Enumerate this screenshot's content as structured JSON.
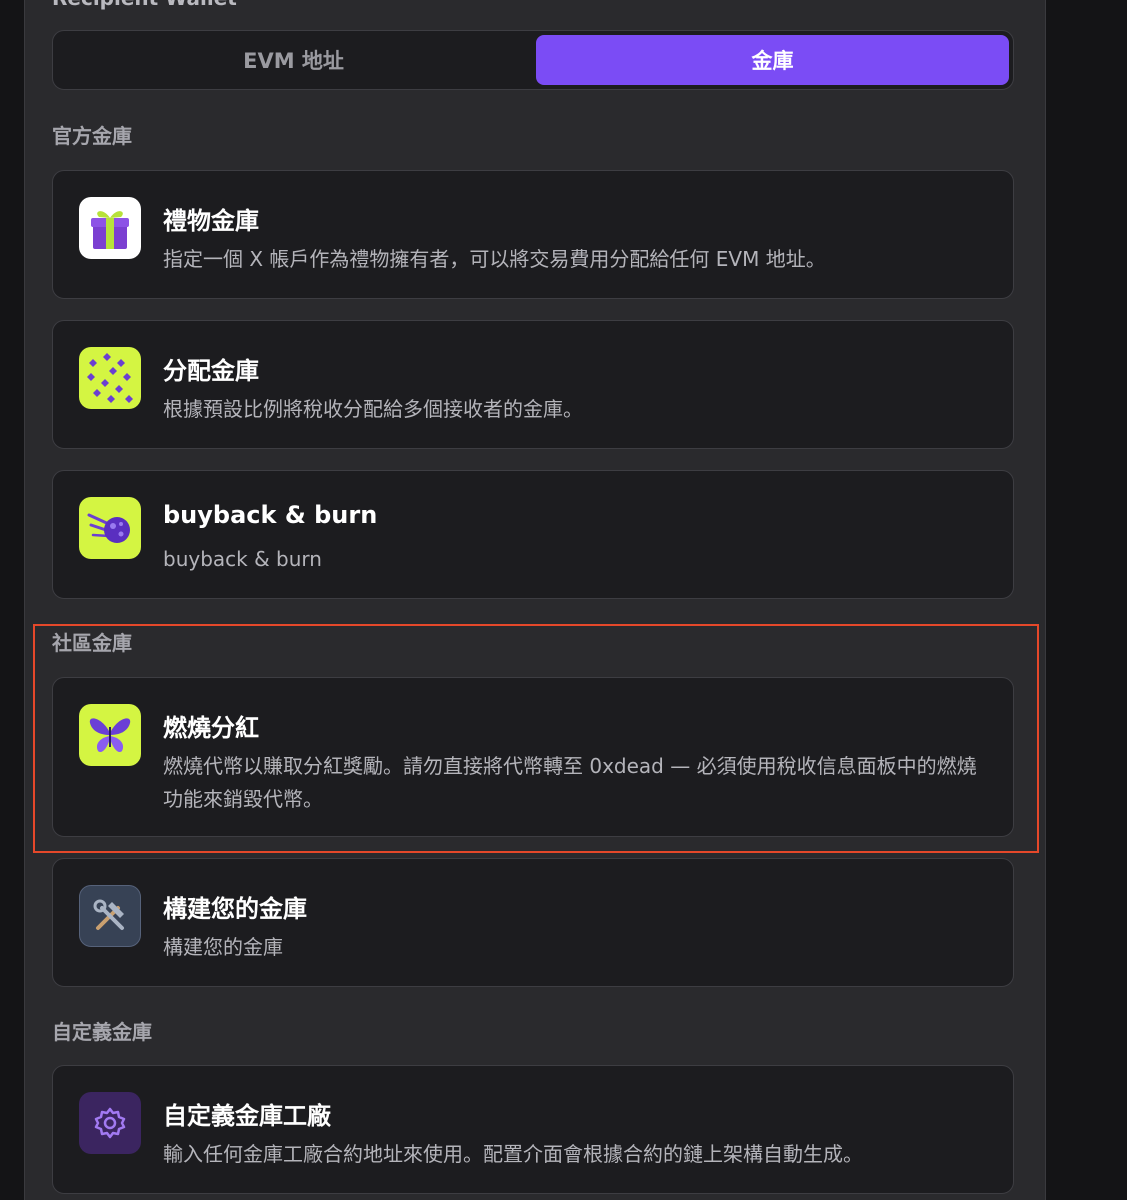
{
  "header": {
    "partial_label": "Recipient Wallet"
  },
  "tabs": [
    {
      "label": "EVM 地址",
      "active": false
    },
    {
      "label": "金庫",
      "active": true
    }
  ],
  "sections": {
    "official": "官方金庫",
    "community": "社區金庫",
    "custom": "自定義金庫"
  },
  "cards": {
    "gift": {
      "title": "禮物金庫",
      "desc": "指定一個 X 帳戶作為禮物擁有者，可以將交易費用分配給任何 EVM 地址。",
      "icon": "gift-icon"
    },
    "split": {
      "title": "分配金庫",
      "desc": "根據預設比例將稅收分配給多個接收者的金庫。",
      "icon": "butterfly-pattern-icon"
    },
    "buyback": {
      "title": "buyback & burn",
      "desc": "buyback & burn",
      "icon": "meteor-icon"
    },
    "burn_dividend": {
      "title": "燃燒分紅",
      "desc": "燃燒代幣以賺取分紅獎勵。請勿直接將代幣轉至 0xdead — 必須使用稅收信息面板中的燃燒功能來銷毀代幣。",
      "icon": "butterfly-icon"
    },
    "build": {
      "title": "構建您的金庫",
      "desc": "構建您的金庫",
      "icon": "hammer-wrench-icon"
    },
    "factory": {
      "title": "自定義金庫工廠",
      "desc": "輸入任何金庫工廠合約地址來使用。配置介面會根據合約的鏈上架構自動生成。",
      "icon": "gear-icon"
    }
  },
  "colors": {
    "accent": "#7b4cf5",
    "highlight": "#e5482a",
    "lime": "#d4f542"
  }
}
